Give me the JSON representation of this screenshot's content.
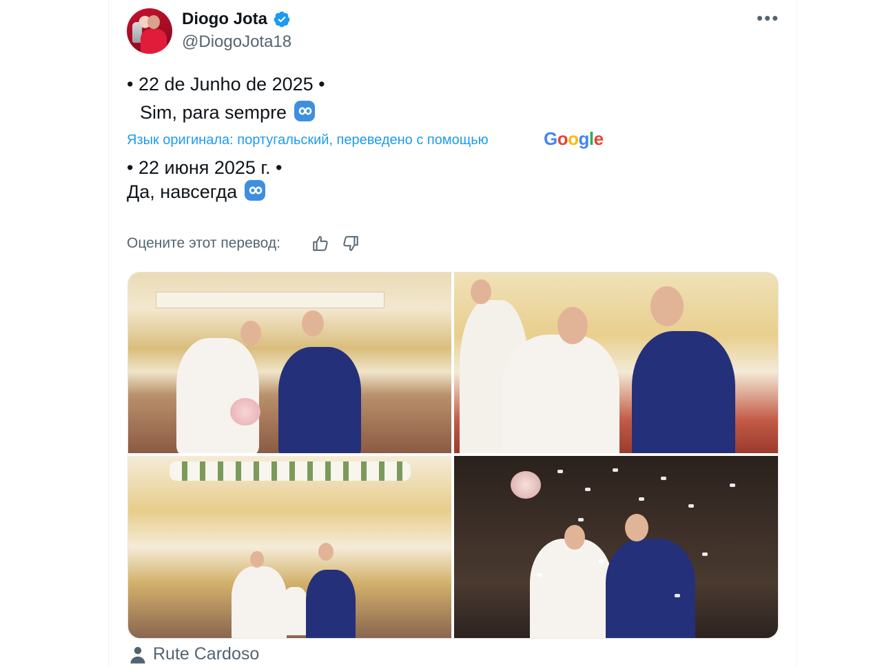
{
  "tweet": {
    "display_name": "Diogo Jota",
    "handle": "@DiogoJota18",
    "verified": true,
    "more_icon": "more-horizontal-icon",
    "original_line1": "• 22 de Junho de 2025 •",
    "original_line2": "Sim, para sempre",
    "translation_note": "Язык оригинала: португальский, переведено с помощью",
    "translation_provider": "Google",
    "translated_line1": "• 22 июня 2025 г. •",
    "translated_line2": "Да, навсегда",
    "emoji": "infinity-emoji",
    "rate_label": "Оцените этот перевод:",
    "rate_icons": [
      "thumbs-up-icon",
      "thumbs-down-icon"
    ]
  },
  "media": {
    "photos": [
      "wedding-altar-photo",
      "wedding-rings-photo",
      "wedding-family-photo",
      "wedding-confetti-photo"
    ],
    "credit": "Rute Cardoso",
    "credit_icon": "person-icon"
  },
  "colors": {
    "accent": "#1d9bf0",
    "secondary_text": "#536471",
    "primary_text": "#0f1419"
  }
}
